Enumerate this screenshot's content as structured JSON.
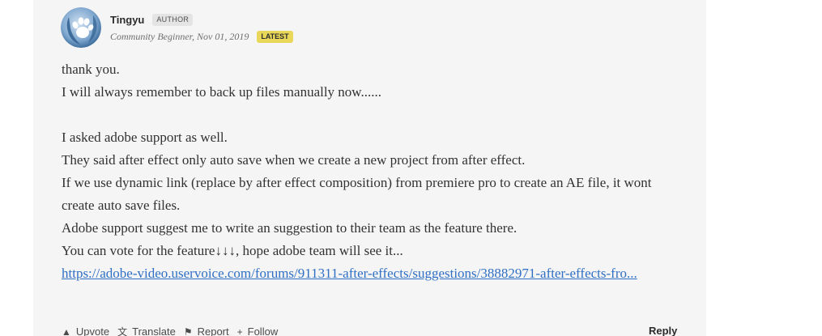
{
  "post": {
    "author": {
      "username": "Tingyu",
      "role_badge": "AUTHOR",
      "rank_and_date": "Community Beginner, Nov 01, 2019",
      "status_badge": "LATEST",
      "avatar_icon": "paw-print-avatar"
    },
    "body": {
      "line1": "thank you.",
      "line2": "I will always remember to back up files manually now......",
      "line3": "I asked adobe support as well.",
      "line4": "They said after effect only auto save when we create a new project from after effect.",
      "line5": "If we use dynamic link (replace by after effect composition) from premiere pro to create an AE file, it wont create auto save files.",
      "line6": "Adobe support suggest me to write an suggestion to their team as the feature there.",
      "line7": "You can vote for the feature↓↓↓, hope adobe team will see it...",
      "link_text": "https://adobe-video.uservoice.com/forums/911311-after-effects/suggestions/38882971-after-effects-fro..."
    },
    "actions": {
      "upvote": "Upvote",
      "translate": "Translate",
      "report": "Report",
      "follow": "Follow",
      "reply": "Reply"
    }
  }
}
